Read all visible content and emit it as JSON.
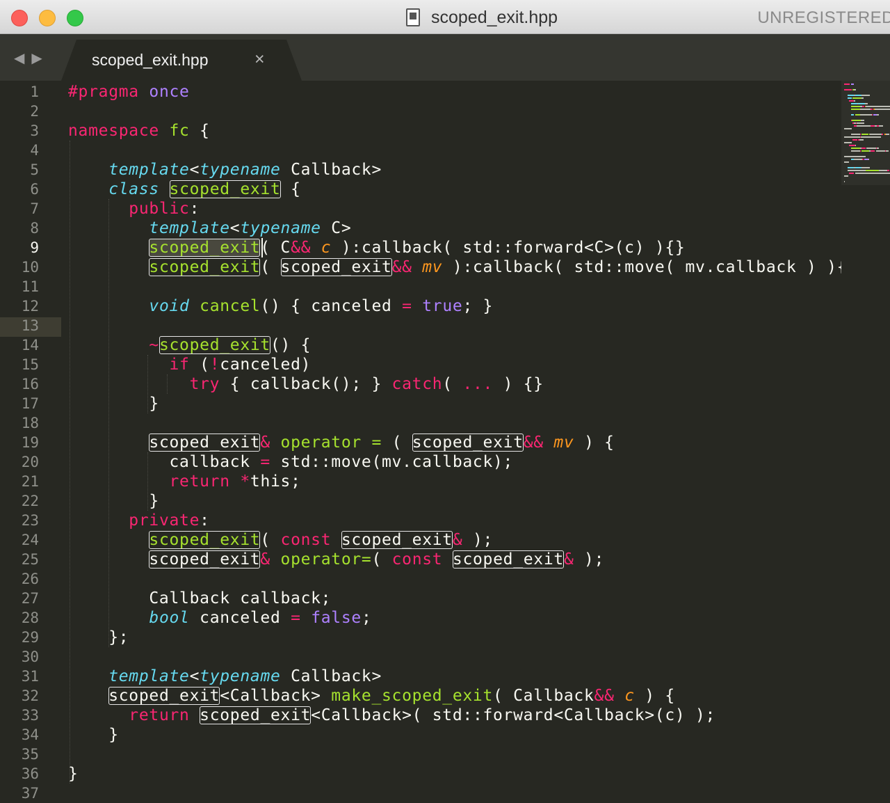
{
  "window": {
    "title": "scoped_exit.hpp",
    "status_right": "UNREGISTERED"
  },
  "tabs": [
    {
      "label": "scoped_exit.hpp",
      "close": "×",
      "active": true
    }
  ],
  "nav": {
    "back": "◀",
    "forward": "▶"
  },
  "colors": {
    "background": "#272822",
    "keyword": "#f92672",
    "storage_type": "#66d9ef",
    "function": "#a6e22e",
    "constant": "#ae81ff",
    "parameter": "#fd971f",
    "text": "#f8f8f2"
  },
  "editor": {
    "current_line": 9,
    "line_numbers": [
      "1",
      "2",
      "3",
      "4",
      "5",
      "6",
      "7",
      "8",
      "9",
      "10",
      "11",
      "12",
      "13",
      "14",
      "15",
      "16",
      "17",
      "18",
      "19",
      "20",
      "21",
      "22",
      "23",
      "24",
      "25",
      "26",
      "27",
      "28",
      "29",
      "30",
      "31",
      "32",
      "33",
      "34",
      "35",
      "36",
      "37"
    ],
    "lines": [
      [
        {
          "t": "#pragma",
          "c": "pk"
        },
        {
          "t": " "
        },
        {
          "t": "once",
          "c": "cn"
        }
      ],
      [],
      [
        {
          "t": "namespace",
          "c": "kw"
        },
        {
          "t": " "
        },
        {
          "t": "fc",
          "c": "fn"
        },
        {
          "t": " {"
        }
      ],
      [],
      [
        {
          "t": "    "
        },
        {
          "t": "template",
          "c": "it"
        },
        {
          "t": "<"
        },
        {
          "t": "typename",
          "c": "it"
        },
        {
          "t": " Callback>"
        }
      ],
      [
        {
          "t": "    "
        },
        {
          "t": "class",
          "c": "it"
        },
        {
          "t": " "
        },
        {
          "t": "scoped_exit",
          "c": "fn box"
        },
        {
          "t": " {"
        }
      ],
      [
        {
          "t": "      "
        },
        {
          "t": "public",
          "c": "kw"
        },
        {
          "t": ":"
        }
      ],
      [
        {
          "t": "        "
        },
        {
          "t": "template",
          "c": "it"
        },
        {
          "t": "<"
        },
        {
          "t": "typename",
          "c": "it"
        },
        {
          "t": " C>"
        }
      ],
      [
        {
          "t": "        "
        },
        {
          "t": "scoped_exit",
          "c": "fn box sel"
        },
        {
          "t": "( C"
        },
        {
          "t": "&&",
          "c": "op"
        },
        {
          "t": " "
        },
        {
          "t": "c",
          "c": "pa"
        },
        {
          "t": " ):callback( std::forward<C>(c) ){}"
        }
      ],
      [
        {
          "t": "        "
        },
        {
          "t": "scoped_exit",
          "c": "fn box"
        },
        {
          "t": "( "
        },
        {
          "t": "scoped_exit",
          "c": "box"
        },
        {
          "t": "&&",
          "c": "op"
        },
        {
          "t": " "
        },
        {
          "t": "mv",
          "c": "pa"
        },
        {
          "t": " ):callback( std::move( mv.callback ) ){}"
        }
      ],
      [],
      [
        {
          "t": "        "
        },
        {
          "t": "void",
          "c": "it"
        },
        {
          "t": " "
        },
        {
          "t": "cancel",
          "c": "fn"
        },
        {
          "t": "() { canceled "
        },
        {
          "t": "=",
          "c": "op"
        },
        {
          "t": " "
        },
        {
          "t": "true",
          "c": "cn"
        },
        {
          "t": "; }"
        }
      ],
      [],
      [
        {
          "t": "        "
        },
        {
          "t": "~",
          "c": "op"
        },
        {
          "t": "scoped_exit",
          "c": "fn box"
        },
        {
          "t": "() {"
        }
      ],
      [
        {
          "t": "          "
        },
        {
          "t": "if",
          "c": "kw"
        },
        {
          "t": " ("
        },
        {
          "t": "!",
          "c": "op"
        },
        {
          "t": "canceled)"
        }
      ],
      [
        {
          "t": "            "
        },
        {
          "t": "try",
          "c": "kw"
        },
        {
          "t": " { callback(); } "
        },
        {
          "t": "catch",
          "c": "kw"
        },
        {
          "t": "( "
        },
        {
          "t": "...",
          "c": "kw"
        },
        {
          "t": " ) {}"
        }
      ],
      [
        {
          "t": "        }"
        }
      ],
      [],
      [
        {
          "t": "        "
        },
        {
          "t": "scoped_exit",
          "c": "box"
        },
        {
          "t": "&",
          "c": "op"
        },
        {
          "t": " "
        },
        {
          "t": "operator",
          "c": "fn"
        },
        {
          "t": " "
        },
        {
          "t": "=",
          "c": "fn"
        },
        {
          "t": " ( "
        },
        {
          "t": "scoped_exit",
          "c": "box"
        },
        {
          "t": "&&",
          "c": "op"
        },
        {
          "t": " "
        },
        {
          "t": "mv",
          "c": "pa"
        },
        {
          "t": " ) {"
        }
      ],
      [
        {
          "t": "          callback "
        },
        {
          "t": "=",
          "c": "op"
        },
        {
          "t": " std::move(mv.callback);"
        }
      ],
      [
        {
          "t": "          "
        },
        {
          "t": "return",
          "c": "kw"
        },
        {
          "t": " "
        },
        {
          "t": "*",
          "c": "op"
        },
        {
          "t": "this;"
        }
      ],
      [
        {
          "t": "        }"
        }
      ],
      [
        {
          "t": "      "
        },
        {
          "t": "private",
          "c": "kw"
        },
        {
          "t": ":"
        }
      ],
      [
        {
          "t": "        "
        },
        {
          "t": "scoped_exit",
          "c": "fn box"
        },
        {
          "t": "( "
        },
        {
          "t": "const",
          "c": "kw"
        },
        {
          "t": " "
        },
        {
          "t": "scoped_exit",
          "c": "box"
        },
        {
          "t": "&",
          "c": "op"
        },
        {
          "t": " );"
        }
      ],
      [
        {
          "t": "        "
        },
        {
          "t": "scoped_exit",
          "c": "box"
        },
        {
          "t": "&",
          "c": "op"
        },
        {
          "t": " "
        },
        {
          "t": "operator=",
          "c": "fn"
        },
        {
          "t": "( "
        },
        {
          "t": "const",
          "c": "kw"
        },
        {
          "t": " "
        },
        {
          "t": "scoped_exit",
          "c": "box"
        },
        {
          "t": "&",
          "c": "op"
        },
        {
          "t": " );"
        }
      ],
      [],
      [
        {
          "t": "        Callback callback;"
        }
      ],
      [
        {
          "t": "        "
        },
        {
          "t": "bool",
          "c": "it"
        },
        {
          "t": " canceled "
        },
        {
          "t": "=",
          "c": "op"
        },
        {
          "t": " "
        },
        {
          "t": "false",
          "c": "cn"
        },
        {
          "t": ";"
        }
      ],
      [
        {
          "t": "    };"
        }
      ],
      [],
      [
        {
          "t": "    "
        },
        {
          "t": "template",
          "c": "it"
        },
        {
          "t": "<"
        },
        {
          "t": "typename",
          "c": "it"
        },
        {
          "t": " Callback>"
        }
      ],
      [
        {
          "t": "    "
        },
        {
          "t": "scoped_exit",
          "c": "box"
        },
        {
          "t": "<Callback> "
        },
        {
          "t": "make_scoped_exit",
          "c": "fn"
        },
        {
          "t": "( Callback"
        },
        {
          "t": "&&",
          "c": "op"
        },
        {
          "t": " "
        },
        {
          "t": "c",
          "c": "pa"
        },
        {
          "t": " ) {"
        }
      ],
      [
        {
          "t": "      "
        },
        {
          "t": "return",
          "c": "kw"
        },
        {
          "t": " "
        },
        {
          "t": "scoped_exit",
          "c": "box"
        },
        {
          "t": "<Callback>( std::forward<Callback>(c) );"
        }
      ],
      [
        {
          "t": "    }"
        }
      ],
      [],
      [
        {
          "t": "}"
        }
      ],
      []
    ]
  }
}
